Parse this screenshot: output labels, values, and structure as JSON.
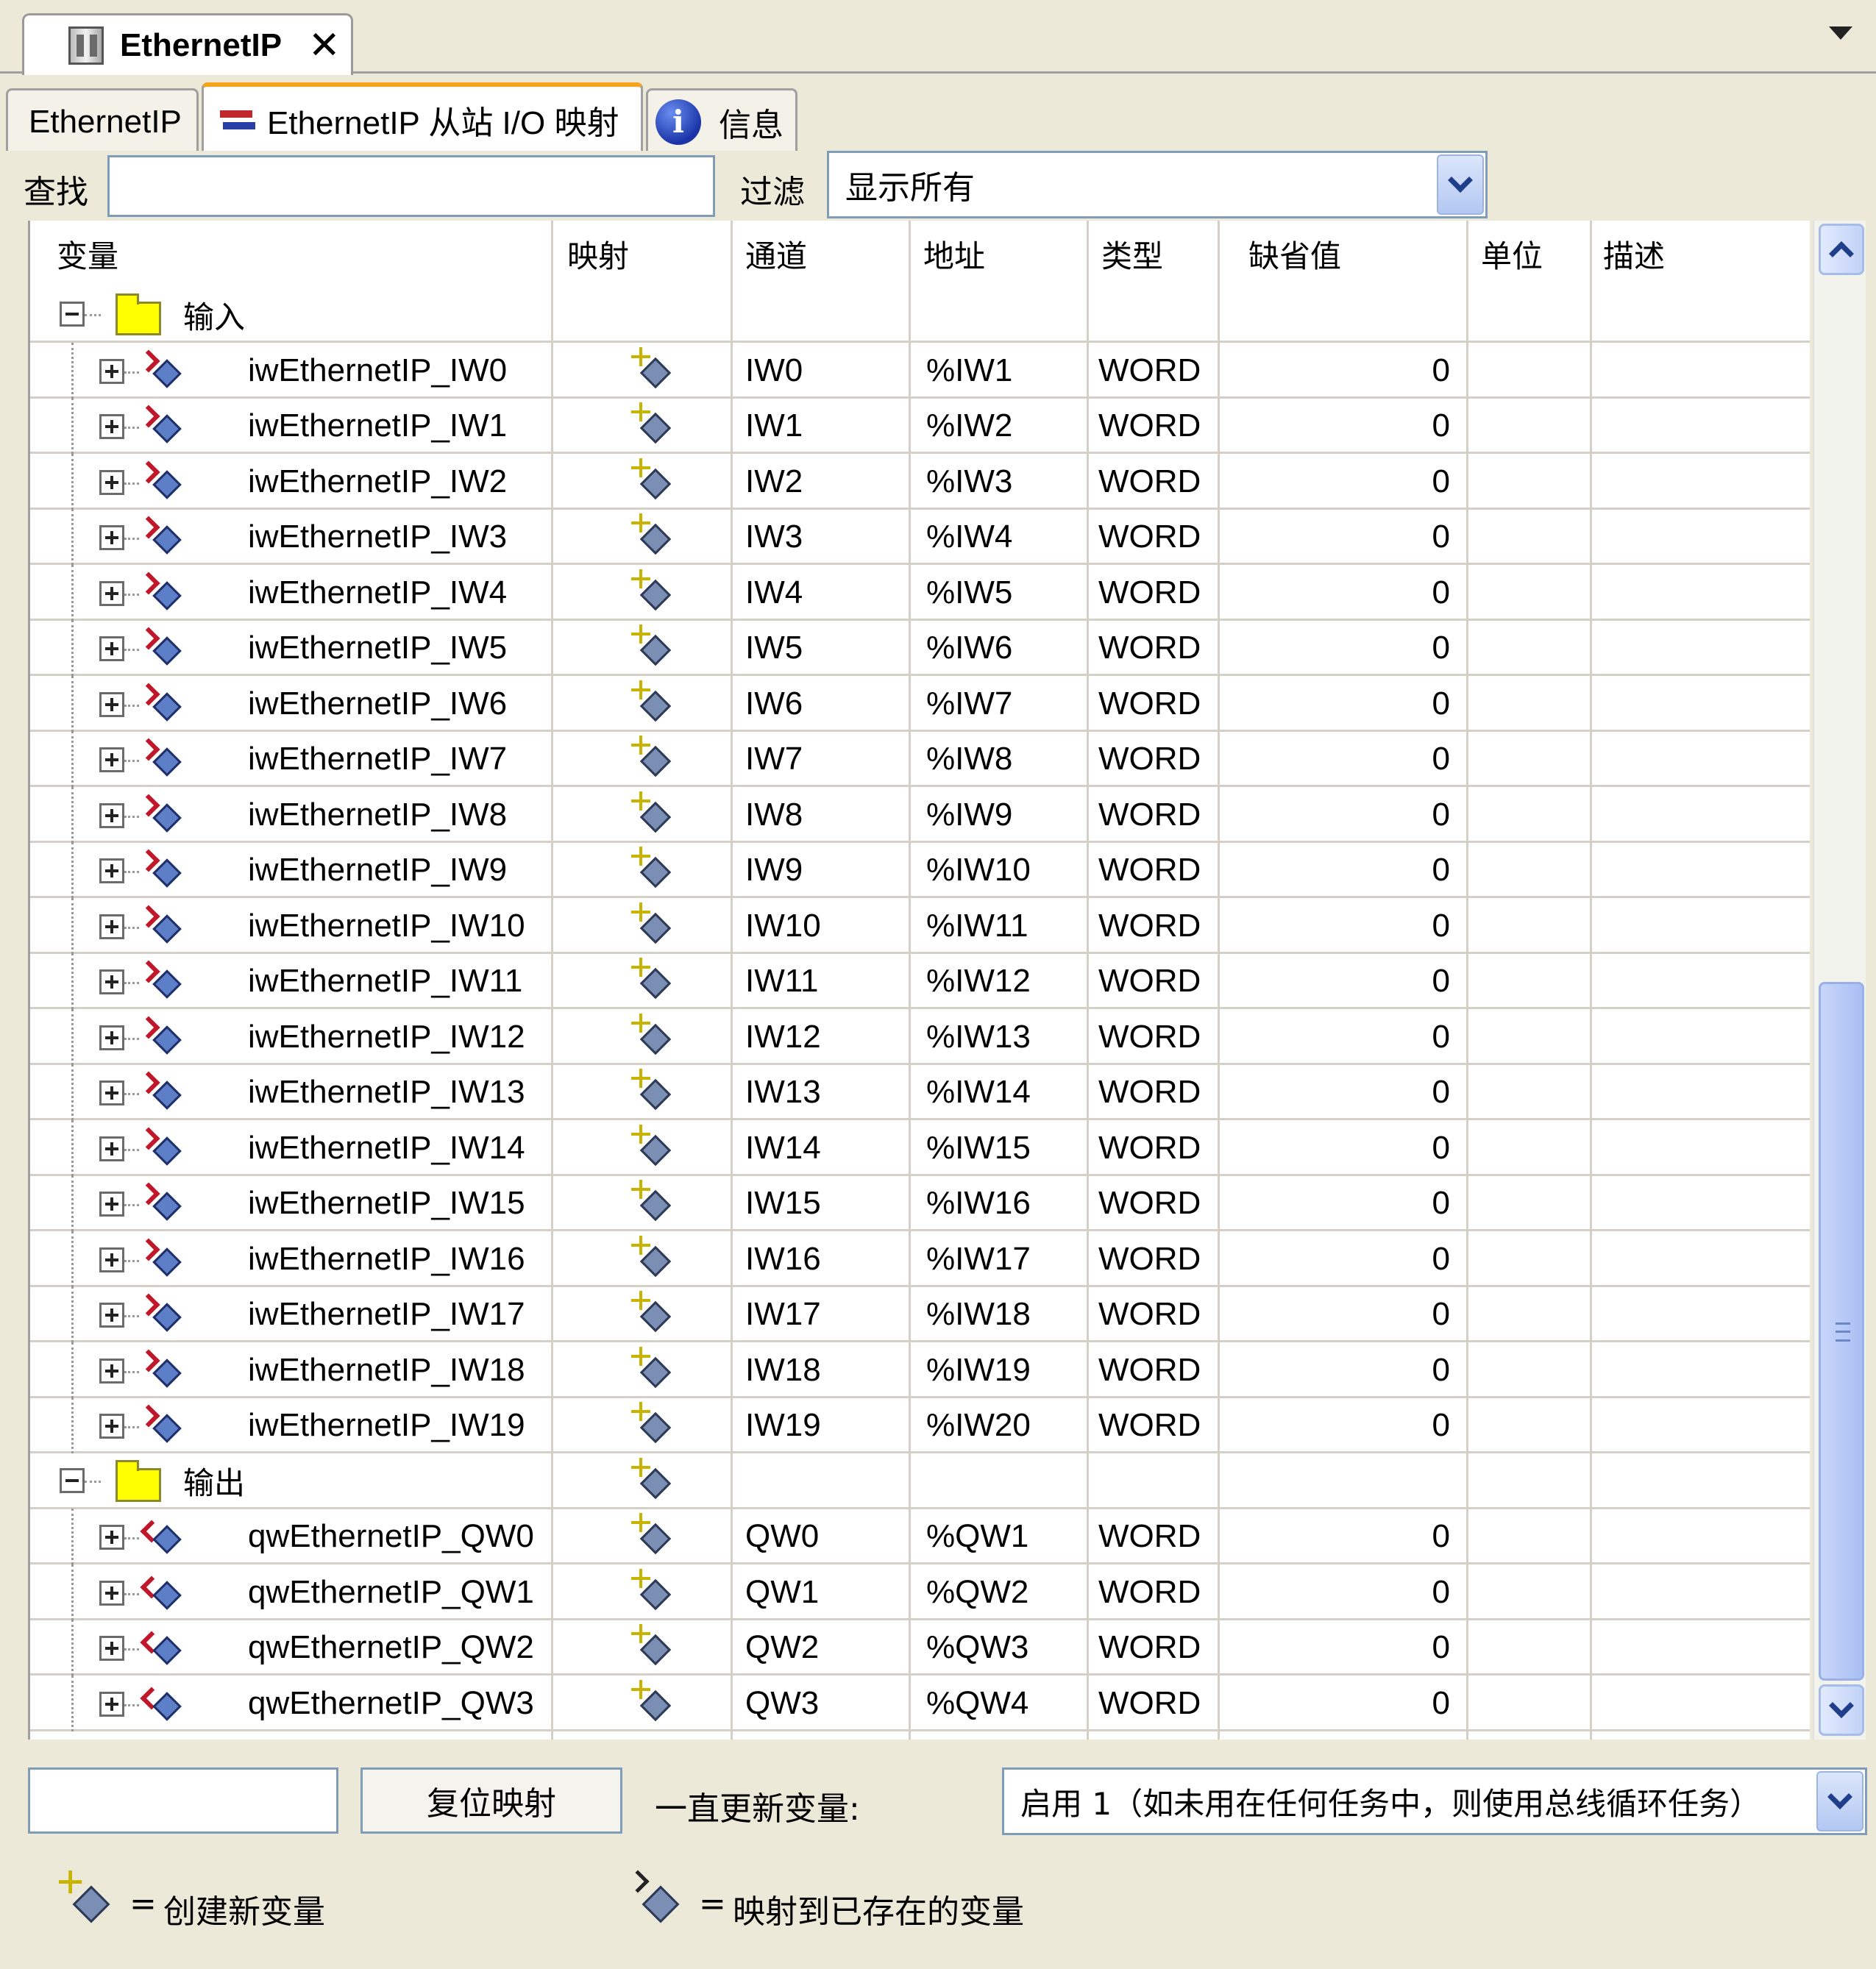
{
  "document_tab": {
    "label": "EthernetIP",
    "close": "✕"
  },
  "tabs": [
    {
      "label": "EthernetIP"
    },
    {
      "label": "EthernetIP 从站 I/O 映射"
    },
    {
      "label": "信息"
    }
  ],
  "search": {
    "label": "查找",
    "value": ""
  },
  "filter": {
    "label": "过滤",
    "selected": "显示所有"
  },
  "columns": {
    "variable": "变量",
    "mapping": "映射",
    "channel": "通道",
    "address": "地址",
    "type": "类型",
    "default": "缺省值",
    "unit": "单位",
    "description": "描述"
  },
  "groups": {
    "inputs": "输入",
    "outputs": "输出"
  },
  "inputs": [
    {
      "name": "iwEthernetIP_IW0",
      "channel": "IW0",
      "address": "%IW1",
      "type": "WORD",
      "default": "0"
    },
    {
      "name": "iwEthernetIP_IW1",
      "channel": "IW1",
      "address": "%IW2",
      "type": "WORD",
      "default": "0"
    },
    {
      "name": "iwEthernetIP_IW2",
      "channel": "IW2",
      "address": "%IW3",
      "type": "WORD",
      "default": "0"
    },
    {
      "name": "iwEthernetIP_IW3",
      "channel": "IW3",
      "address": "%IW4",
      "type": "WORD",
      "default": "0"
    },
    {
      "name": "iwEthernetIP_IW4",
      "channel": "IW4",
      "address": "%IW5",
      "type": "WORD",
      "default": "0"
    },
    {
      "name": "iwEthernetIP_IW5",
      "channel": "IW5",
      "address": "%IW6",
      "type": "WORD",
      "default": "0"
    },
    {
      "name": "iwEthernetIP_IW6",
      "channel": "IW6",
      "address": "%IW7",
      "type": "WORD",
      "default": "0"
    },
    {
      "name": "iwEthernetIP_IW7",
      "channel": "IW7",
      "address": "%IW8",
      "type": "WORD",
      "default": "0"
    },
    {
      "name": "iwEthernetIP_IW8",
      "channel": "IW8",
      "address": "%IW9",
      "type": "WORD",
      "default": "0"
    },
    {
      "name": "iwEthernetIP_IW9",
      "channel": "IW9",
      "address": "%IW10",
      "type": "WORD",
      "default": "0"
    },
    {
      "name": "iwEthernetIP_IW10",
      "channel": "IW10",
      "address": "%IW11",
      "type": "WORD",
      "default": "0"
    },
    {
      "name": "iwEthernetIP_IW11",
      "channel": "IW11",
      "address": "%IW12",
      "type": "WORD",
      "default": "0"
    },
    {
      "name": "iwEthernetIP_IW12",
      "channel": "IW12",
      "address": "%IW13",
      "type": "WORD",
      "default": "0"
    },
    {
      "name": "iwEthernetIP_IW13",
      "channel": "IW13",
      "address": "%IW14",
      "type": "WORD",
      "default": "0"
    },
    {
      "name": "iwEthernetIP_IW14",
      "channel": "IW14",
      "address": "%IW15",
      "type": "WORD",
      "default": "0"
    },
    {
      "name": "iwEthernetIP_IW15",
      "channel": "IW15",
      "address": "%IW16",
      "type": "WORD",
      "default": "0"
    },
    {
      "name": "iwEthernetIP_IW16",
      "channel": "IW16",
      "address": "%IW17",
      "type": "WORD",
      "default": "0"
    },
    {
      "name": "iwEthernetIP_IW17",
      "channel": "IW17",
      "address": "%IW18",
      "type": "WORD",
      "default": "0"
    },
    {
      "name": "iwEthernetIP_IW18",
      "channel": "IW18",
      "address": "%IW19",
      "type": "WORD",
      "default": "0"
    },
    {
      "name": "iwEthernetIP_IW19",
      "channel": "IW19",
      "address": "%IW20",
      "type": "WORD",
      "default": "0"
    }
  ],
  "outputs": [
    {
      "name": "qwEthernetIP_QW0",
      "channel": "QW0",
      "address": "%QW1",
      "type": "WORD",
      "default": "0"
    },
    {
      "name": "qwEthernetIP_QW1",
      "channel": "QW1",
      "address": "%QW2",
      "type": "WORD",
      "default": "0"
    },
    {
      "name": "qwEthernetIP_QW2",
      "channel": "QW2",
      "address": "%QW3",
      "type": "WORD",
      "default": "0"
    },
    {
      "name": "qwEthernetIP_QW3",
      "channel": "QW3",
      "address": "%QW4",
      "type": "WORD",
      "default": "0"
    }
  ],
  "bottom": {
    "reset_button": "复位映射",
    "always_update_label": "一直更新变量:",
    "task_selected": "启用 1（如未用在任何任务中，则使用总线循环任务）"
  },
  "legend": {
    "eq": "=",
    "create_new": "创建新变量",
    "map_existing": "映射到已存在的变量"
  },
  "icons": {
    "device": "device-icon",
    "close": "close-icon",
    "mapping_tab": "io-mapping-icon",
    "info": "info-icon",
    "folder": "folder-icon",
    "input_var": "input-variable-icon",
    "output_var": "output-variable-icon",
    "create_var": "create-variable-icon",
    "map_existing": "map-existing-variable-icon"
  },
  "colors": {
    "folder": "#ffff00",
    "tab_accent": "#f6a41c",
    "background": "#ece9d8"
  }
}
